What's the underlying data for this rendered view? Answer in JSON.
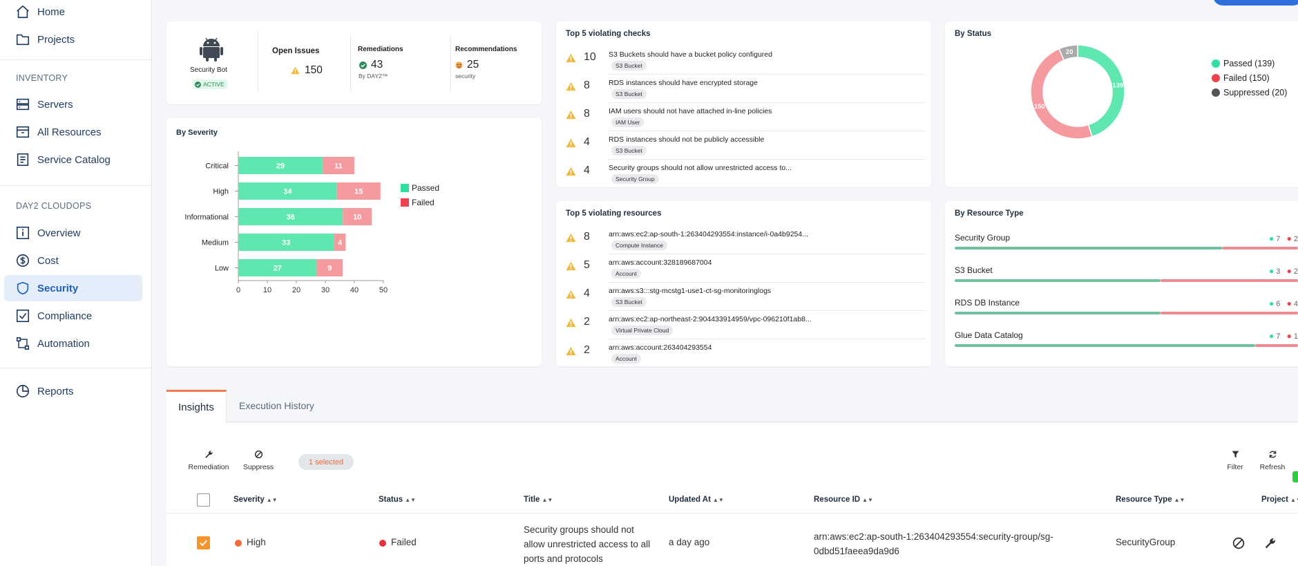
{
  "sidebar": {
    "items": [
      {
        "label": "Home"
      },
      {
        "label": "Projects"
      },
      {
        "label": "Servers"
      },
      {
        "label": "All Resources"
      },
      {
        "label": "Service Catalog"
      },
      {
        "label": "Overview"
      },
      {
        "label": "Cost"
      },
      {
        "label": "Security"
      },
      {
        "label": "Compliance"
      },
      {
        "label": "Automation"
      },
      {
        "label": "Reports"
      }
    ],
    "sections": {
      "inventory": "INVENTORY",
      "cloudops": "DAY2 CLOUDOPS"
    }
  },
  "bot": {
    "name": "Security Bot",
    "status": "ACTIVE",
    "open_issues_label": "Open Issues",
    "open_issues": "150",
    "remediations_label": "Remediations",
    "remediations": "43",
    "remediations_sub": "By DAY2™",
    "recommendations_label": "Recommendations",
    "recommendations": "25",
    "recommendations_sub": "security"
  },
  "severity_card": {
    "title": "By Severity",
    "legend_passed": "Passed",
    "legend_failed": "Failed"
  },
  "status_card": {
    "title": "By Status"
  },
  "checks_card": {
    "title": "Top 5 violating checks",
    "items": [
      {
        "count": "10",
        "title": "S3 Buckets should have a bucket policy configured",
        "tag": "S3 Bucket"
      },
      {
        "count": "8",
        "title": "RDS instances should have encrypted storage",
        "tag": "S3 Bucket"
      },
      {
        "count": "8",
        "title": "IAM users should not have attached in-line policies",
        "tag": "IAM User"
      },
      {
        "count": "4",
        "title": "RDS instances should not be publicly accessible",
        "tag": "S3 Bucket"
      },
      {
        "count": "4",
        "title": "Security groups should not allow unrestricted access to...",
        "tag": "Security Group"
      }
    ]
  },
  "resources_card": {
    "title": "Top 5 violating resources",
    "items": [
      {
        "count": "8",
        "title": "arn:aws:ec2:ap-south-1:263404293554:instance/i-0a4b9254...",
        "tag": "Compute Instance"
      },
      {
        "count": "5",
        "title": "arn:aws:account:328189687004",
        "tag": "Account"
      },
      {
        "count": "4",
        "title": "arn:aws:s3:::stg-mcstg1-use1-ct-sg-monitoringlogs",
        "tag": "S3 Bucket"
      },
      {
        "count": "2",
        "title": "arn:aws:ec2:ap-northeast-2:904433914959/vpc-096210f1ab8...",
        "tag": "Virtual Private Cloud"
      },
      {
        "count": "2",
        "title": "arn:aws:account:263404293554",
        "tag": "Account"
      }
    ]
  },
  "resource_type_card": {
    "title": "By Resource Type",
    "items": [
      {
        "name": "Security Group",
        "passed": "7",
        "failed": "2"
      },
      {
        "name": "S3 Bucket",
        "passed": "3",
        "failed": "2"
      },
      {
        "name": "RDS DB Instance",
        "passed": "6",
        "failed": "4"
      },
      {
        "name": "Glue Data Catalog",
        "passed": "7",
        "failed": "1"
      }
    ]
  },
  "tabs": [
    {
      "label": "Insights"
    },
    {
      "label": "Execution History"
    }
  ],
  "toolbar": {
    "remediation": "Remediation",
    "suppress": "Suppress",
    "selected": "1 selected",
    "filter": "Filter",
    "refresh": "Refresh"
  },
  "table": {
    "headers": [
      "Severity",
      "Status",
      "Title",
      "Updated At",
      "Resource ID",
      "Resource Type",
      "Project"
    ],
    "rows": [
      {
        "severity": "High",
        "status": "Failed",
        "title_lines": [
          "Security groups should not",
          "allow unrestricted access to all",
          "ports and protocols"
        ],
        "updated": "a day ago",
        "resource_lines": [
          "arn:aws:ec2:ap-south-1:263404293554:security-group/sg-",
          "0dbd51faeea9da9d6"
        ],
        "resource_type": "SecurityGroup"
      }
    ]
  },
  "colors": {
    "passed": "#5ee8b0",
    "failed": "#f59a9f",
    "suppressed": "#aaaaaa",
    "accent": "#1f5fb8",
    "warning": "#f0b93a"
  },
  "chart_data": [
    {
      "type": "bar",
      "title": "By Severity",
      "categories": [
        "Critical",
        "High",
        "Informational",
        "Medium",
        "Low"
      ],
      "series": [
        {
          "name": "Passed",
          "values": [
            29,
            34,
            36,
            33,
            27
          ]
        },
        {
          "name": "Failed",
          "values": [
            11,
            15,
            10,
            4,
            9
          ]
        }
      ],
      "xlim": [
        0,
        50
      ],
      "xticks": [
        0,
        10,
        20,
        30,
        40,
        50
      ],
      "orientation": "horizontal",
      "stacked": true
    },
    {
      "type": "pie",
      "title": "By Status",
      "donut": true,
      "labels": [
        "Passed",
        "Failed",
        "Suppressed"
      ],
      "values": [
        139,
        150,
        20
      ],
      "legend": [
        "Passed (139)",
        "Failed (150)",
        "Suppressed (20)"
      ],
      "legend_position": "right"
    }
  ]
}
